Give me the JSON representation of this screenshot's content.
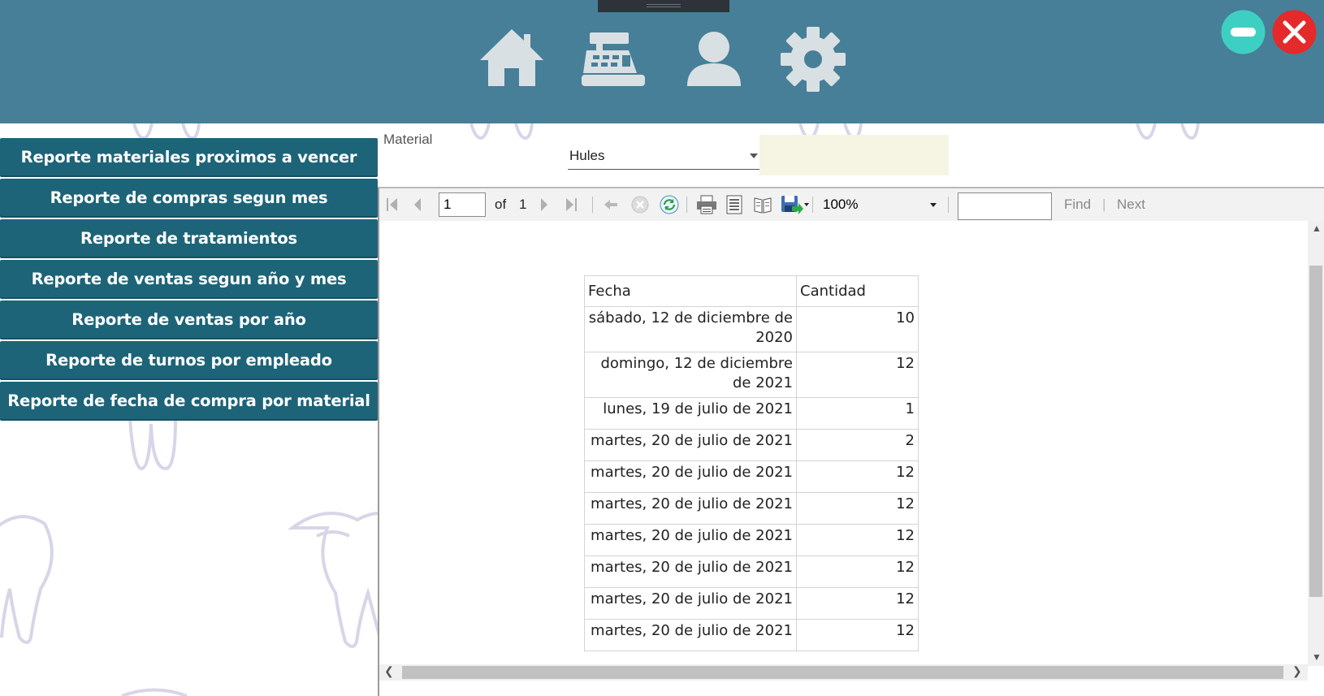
{
  "header": {
    "nav": [
      {
        "name": "home",
        "icon": "home-icon"
      },
      {
        "name": "cash-register",
        "icon": "cash-register-icon"
      },
      {
        "name": "user",
        "icon": "user-icon"
      },
      {
        "name": "settings",
        "icon": "gear-icon"
      }
    ],
    "window_buttons": [
      {
        "name": "minimize",
        "icon": "minus-icon",
        "color": "#3ecfc3"
      },
      {
        "name": "close",
        "icon": "close-icon",
        "color": "#e42a2a"
      }
    ],
    "color": "#477f98"
  },
  "sidebar": {
    "color": "#1d6478",
    "items": [
      {
        "label": "Reporte materiales proximos a vencer"
      },
      {
        "label": "Reporte de compras segun mes"
      },
      {
        "label": "Reporte de tratamientos"
      },
      {
        "label": "Reporte de ventas segun año y mes"
      },
      {
        "label": "Reporte de ventas por año"
      },
      {
        "label": "Reporte de turnos por empleado"
      },
      {
        "label": "Reporte de fecha de compra por material"
      }
    ]
  },
  "filter": {
    "material_label": "Material",
    "material_value": "Hules"
  },
  "toolbar": {
    "page_value": "1",
    "of_label": "of",
    "total_pages": "1",
    "zoom": "100%",
    "find_label": "Find",
    "separator": "|",
    "next_label": "Next",
    "icons": [
      "first-page-icon",
      "prev-page-icon",
      "next-page-icon",
      "last-page-icon",
      "back-icon",
      "stop-icon",
      "refresh-icon",
      "print-icon",
      "print-layout-icon",
      "page-setup-icon",
      "export-icon"
    ]
  },
  "report": {
    "columns": [
      "Fecha",
      "Cantidad"
    ],
    "rows": [
      {
        "fecha": "sábado, 12 de diciembre de 2020",
        "cantidad": "10"
      },
      {
        "fecha": "domingo, 12 de diciembre de 2021",
        "cantidad": "12"
      },
      {
        "fecha": "lunes, 19 de julio de 2021",
        "cantidad": "1"
      },
      {
        "fecha": "martes, 20 de julio de 2021",
        "cantidad": "2"
      },
      {
        "fecha": "martes, 20 de julio de 2021",
        "cantidad": "12"
      },
      {
        "fecha": "martes, 20 de julio de 2021",
        "cantidad": "12"
      },
      {
        "fecha": "martes, 20 de julio de 2021",
        "cantidad": "12"
      },
      {
        "fecha": "martes, 20 de julio de 2021",
        "cantidad": "12"
      },
      {
        "fecha": "martes, 20 de julio de 2021",
        "cantidad": "12"
      },
      {
        "fecha": "martes, 20 de julio de 2021",
        "cantidad": "12"
      }
    ]
  }
}
